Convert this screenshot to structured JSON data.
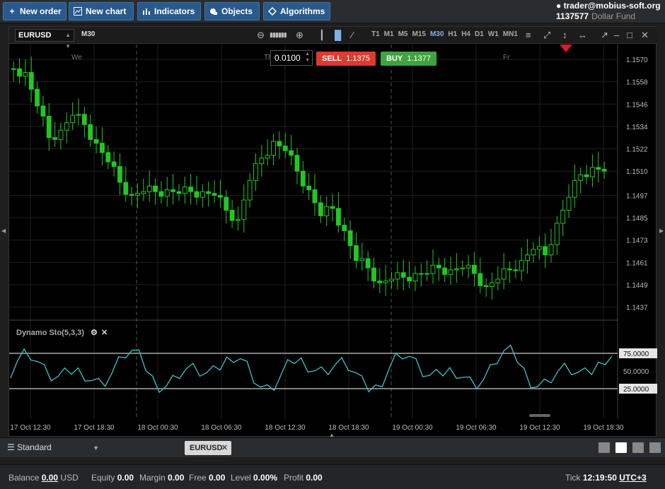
{
  "toolbar": {
    "new_order": "New order",
    "new_chart": "New chart",
    "indicators": "Indicators",
    "objects": "Objects",
    "algorithms": "Algorithms"
  },
  "account": {
    "user": "trader@mobius-soft.org",
    "number": "1137577",
    "fund": "Dollar Fund"
  },
  "chart": {
    "symbol": "EURUSD",
    "timeframe": "M30",
    "timeframes": [
      "T1",
      "M1",
      "M5",
      "M15",
      "M30",
      "H1",
      "H4",
      "D1",
      "W1",
      "MN1"
    ],
    "active_timeframe": "M30",
    "lot": "0.0100",
    "sell_label": "SELL",
    "sell_price": "1.1375",
    "buy_label": "BUY",
    "buy_price": "1.1377",
    "day_labels": [
      "We",
      "Th",
      "Fr"
    ],
    "price_ticks": [
      "1.1570",
      "1.1558",
      "1.1546",
      "1.1534",
      "1.1522",
      "1.1510",
      "1.1497",
      "1.1485",
      "1.1473",
      "1.1461",
      "1.1449",
      "1.1437"
    ],
    "time_ticks": [
      "17 Oct 12:30",
      "17 Oct 18:30",
      "18 Oct 00:30",
      "18 Oct 06:30",
      "18 Oct 12:30",
      "18 Oct 18:30",
      "19 Oct 00:30",
      "19 Oct 06:30",
      "19 Oct 12:30",
      "19 Oct 18:30"
    ],
    "oscillator": {
      "name": "Dynamo Sto(5,3,3)",
      "levels": [
        "75.0000",
        "50.0000",
        "25.0000"
      ]
    },
    "colors": {
      "up": "#22c722",
      "down": "#22c722",
      "osc": "#3fc1c9",
      "sell": "#e0392f",
      "buy": "#3fa33f"
    }
  },
  "chart_data": {
    "type": "candlestick",
    "x_range": [
      "17 Oct 12:30",
      "19 Oct 18:30"
    ],
    "y_range": [
      1.143,
      1.1578
    ],
    "series_close_approx": [
      1.1565,
      1.1563,
      1.1545,
      1.1528,
      1.1532,
      1.154,
      1.1535,
      1.1525,
      1.1515,
      1.1504,
      1.1497,
      1.1499,
      1.1499,
      1.15,
      1.1498,
      1.1499,
      1.1499,
      1.1497,
      1.1489,
      1.1484,
      1.1505,
      1.1517,
      1.1526,
      1.1521,
      1.151,
      1.15,
      1.1486,
      1.149,
      1.1478,
      1.1462,
      1.1458,
      1.145,
      1.1452,
      1.1453,
      1.1455,
      1.1455,
      1.1458,
      1.1457,
      1.1458,
      1.1455,
      1.1448,
      1.1452,
      1.1457,
      1.1462,
      1.1468,
      1.1465,
      1.1482,
      1.1496,
      1.1508,
      1.1512,
      1.151
    ],
    "oscillator_levels": [
      75,
      50,
      25
    ]
  },
  "tabs": {
    "workspace": "Standard",
    "chart_tab": "EURUSD"
  },
  "status": {
    "balance_label": "Balance",
    "balance": "0.00",
    "currency": "USD",
    "equity_label": "Equity",
    "equity": "0.00",
    "margin_label": "Margin",
    "margin": "0.00",
    "free_label": "Free",
    "free": "0.00",
    "level_label": "Level",
    "level": "0.00%",
    "profit_label": "Profit",
    "profit": "0.00",
    "tick_label": "Tick",
    "time": "12:19:50",
    "tz": "UTC+3"
  }
}
